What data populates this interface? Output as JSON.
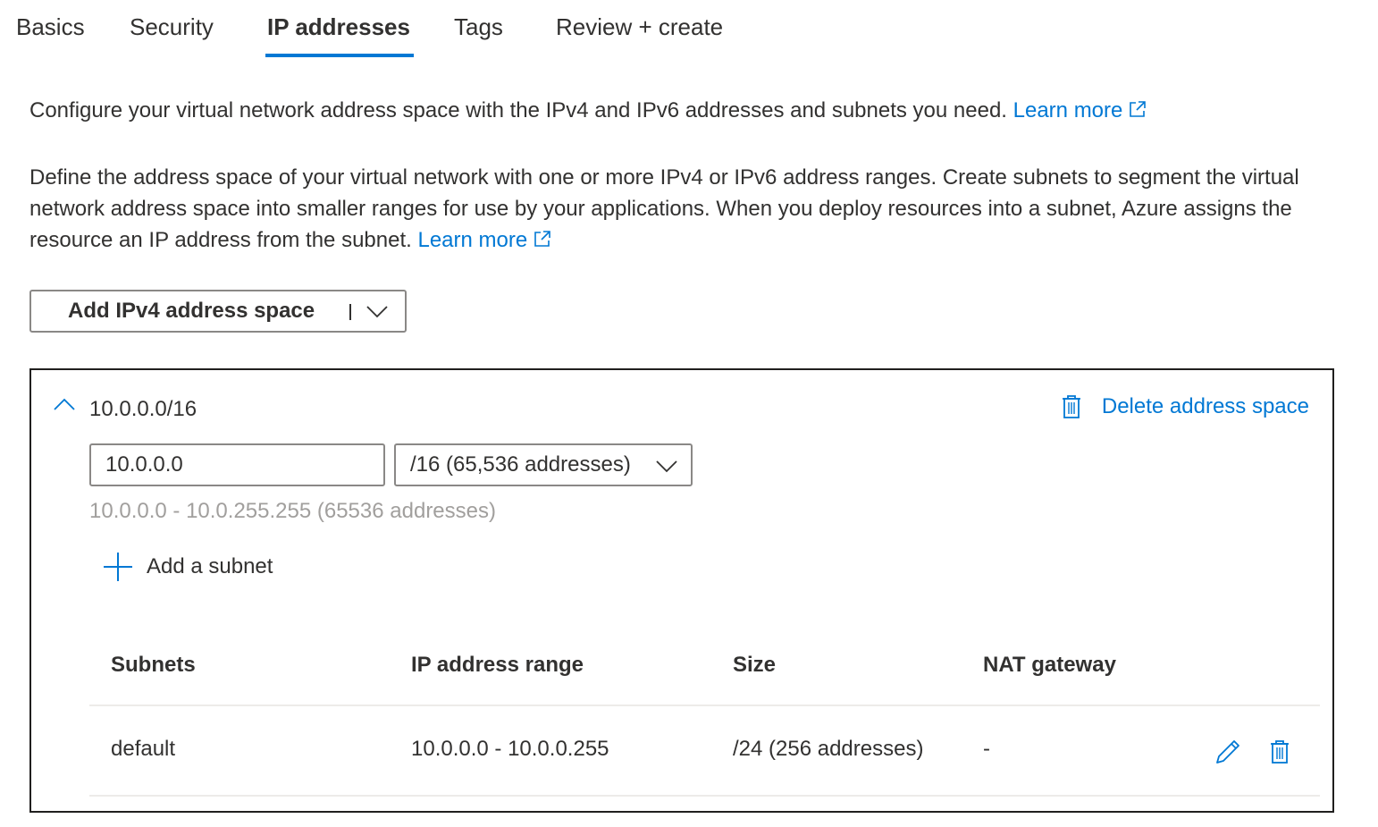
{
  "tabs": [
    {
      "label": "Basics",
      "active": false
    },
    {
      "label": "Security",
      "active": false
    },
    {
      "label": "IP addresses",
      "active": true
    },
    {
      "label": "Tags",
      "active": false
    },
    {
      "label": "Review + create",
      "active": false
    }
  ],
  "intro": {
    "text": "Configure your virtual network address space with the IPv4 and IPv6 addresses and subnets you need.",
    "link": "Learn more"
  },
  "description": {
    "text": "Define the address space of your virtual network with one or more IPv4 or IPv6 address ranges. Create subnets to segment the virtual network address space into smaller ranges for use by your applications. When you deploy resources into a subnet, Azure assigns the resource an IP address from the subnet.",
    "link": "Learn more"
  },
  "add_space_button": {
    "label": "Add IPv4 address space",
    "icon": "chevron-down-icon"
  },
  "address_space": {
    "title": "10.0.0.0/16",
    "expanded": true,
    "delete_label": "Delete address space",
    "address_value": "10.0.0.0",
    "prefix_selected": "/16 (65,536 addresses)",
    "range_hint": "10.0.0.0 - 10.0.255.255 (65536 addresses)",
    "add_subnet_label": "Add a subnet",
    "subnet_table": {
      "columns": [
        "Subnets",
        "IP address range",
        "Size",
        "NAT gateway"
      ],
      "rows": [
        {
          "name": "default",
          "range": "10.0.0.0 - 10.0.0.255",
          "size": "/24 (256 addresses)",
          "nat_gateway": "-"
        }
      ]
    }
  },
  "colors": {
    "accent": "#0078d4",
    "text": "#323130",
    "muted": "#a19f9d",
    "border": "#8a8886",
    "box_border": "#201f1e",
    "divider": "#edebe9"
  }
}
